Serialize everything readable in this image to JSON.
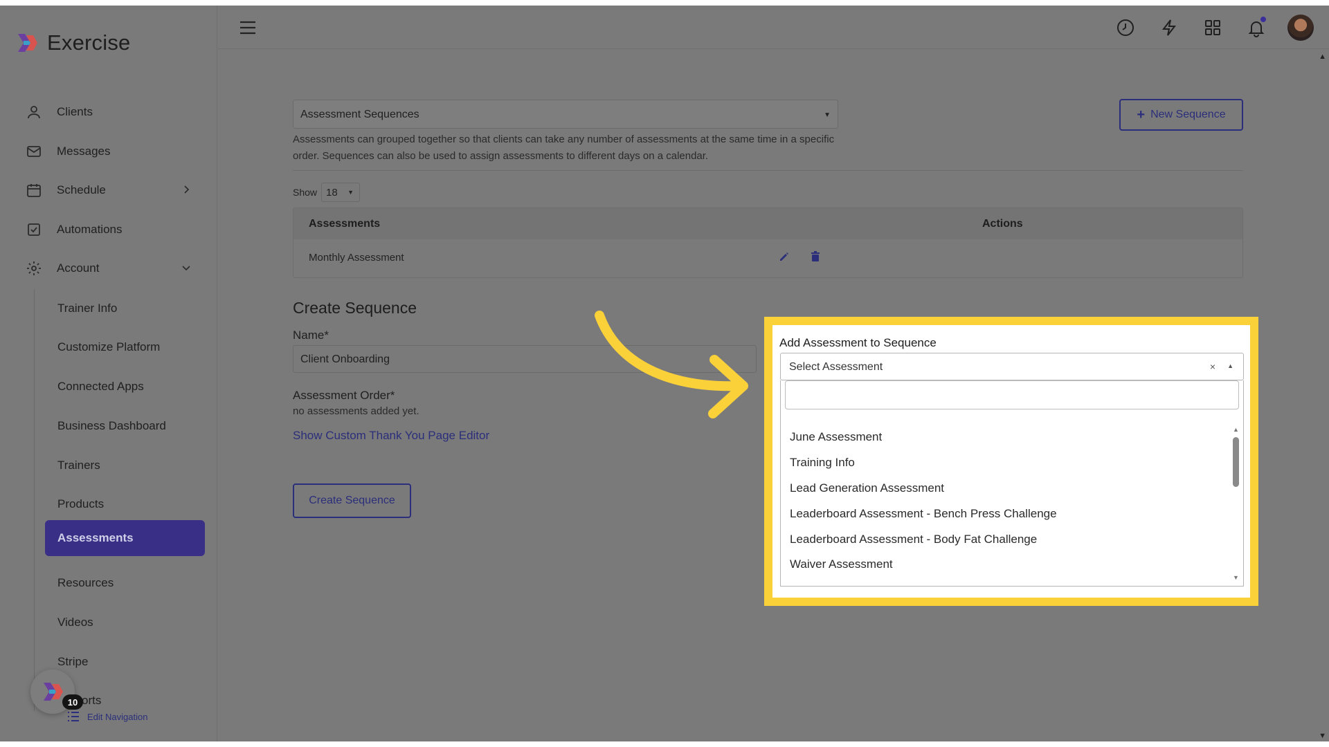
{
  "app": {
    "name": "Exercise"
  },
  "sidebar": {
    "items": [
      {
        "label": "Clients",
        "icon": "user-icon"
      },
      {
        "label": "Messages",
        "icon": "mail-icon"
      },
      {
        "label": "Schedule",
        "icon": "calendar-icon"
      },
      {
        "label": "Automations",
        "icon": "checkbox-icon"
      },
      {
        "label": "Account",
        "icon": "gear-icon"
      }
    ],
    "subitems": [
      "Trainer Info",
      "Customize Platform",
      "Connected Apps",
      "Business Dashboard",
      "Trainers",
      "Products",
      "Assessments",
      "Resources",
      "Videos",
      "Stripe",
      "orts"
    ],
    "active_subitem": "Assessments",
    "launcher_badge": "10",
    "edit_navigation": "Edit Navigation",
    "accent": "#3a2f87"
  },
  "header": {
    "icons": [
      "menu-icon",
      "history-icon",
      "lightning-icon",
      "grid-icon",
      "bell-icon",
      "avatar"
    ]
  },
  "main": {
    "sequence_select": "Assessment Sequences",
    "help_text": "Assessments can grouped together so that clients can take any number of assessments at the same time in a specific order. Sequences can also be used to assign assessments to different days on a calendar.",
    "new_sequence_button": "New Sequence",
    "show_label": "Show",
    "show_value": "18",
    "table": {
      "headers": [
        "Assessments",
        "Actions"
      ],
      "rows": [
        {
          "assessment": "Monthly Assessment"
        }
      ]
    },
    "create_title": "Create Sequence",
    "name_label": "Name*",
    "name_value": "Client Onboarding",
    "order_label": "Assessment Order*",
    "order_empty": "no assessments added yet.",
    "thank_you_link": "Show Custom Thank You Page Editor",
    "create_button": "Create Sequence"
  },
  "add_panel": {
    "label": "Add Assessment to Sequence",
    "placeholder": "Select Assessment",
    "clear": "×",
    "options": [
      "June Assessment",
      "Training Info",
      "Lead Generation Assessment",
      "Leaderboard Assessment - Bench Press Challenge",
      "Leaderboard Assessment - Body Fat Challenge",
      "Waiver Assessment"
    ],
    "highlight_color": "#fbd13a",
    "arrow_color": "#fbd13a"
  }
}
